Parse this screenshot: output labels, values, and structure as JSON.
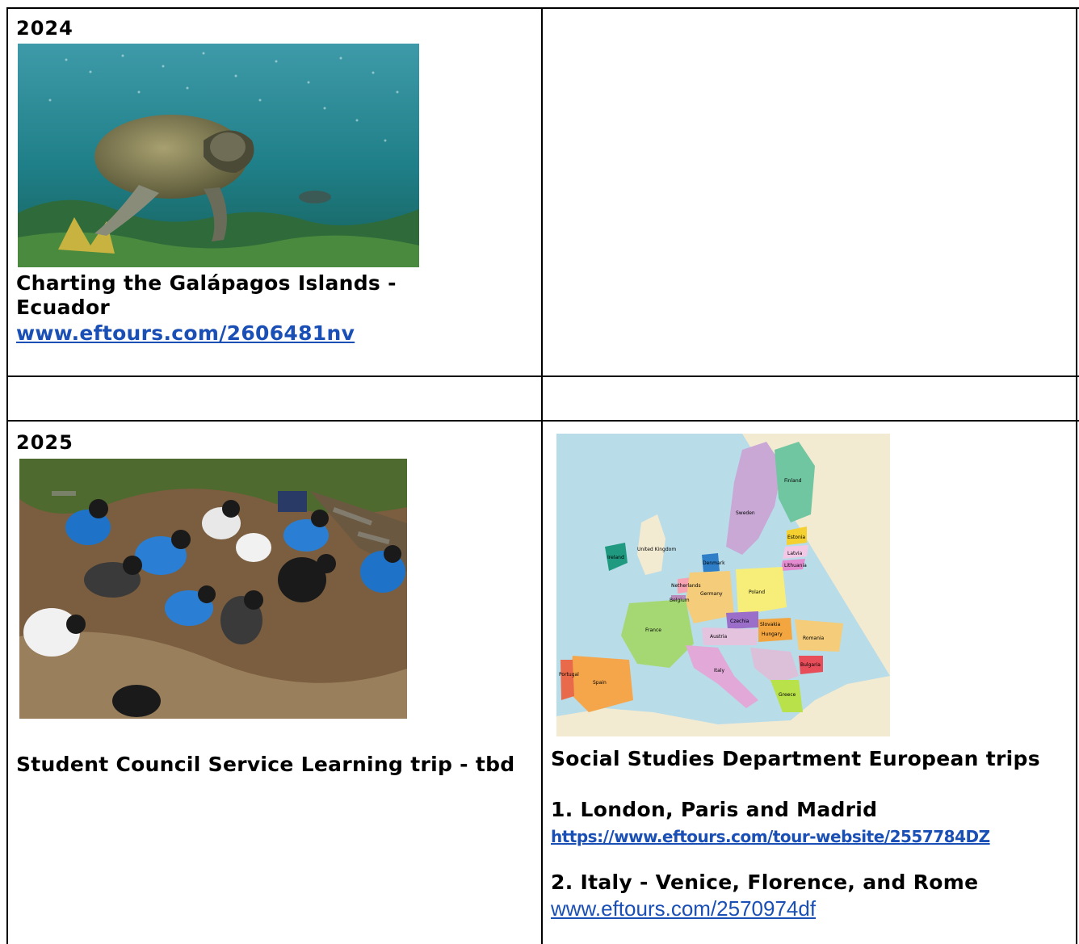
{
  "cells": {
    "galapagos": {
      "year": "2024",
      "image_alt": "sea turtle underwater",
      "title": "Charting the Galápagos Islands - Ecuador",
      "link": "www.eftours.com/2606481nv"
    },
    "service": {
      "year": "2025",
      "image_alt": "students working outdoors",
      "title": "Student Council Service Learning trip - tbd"
    },
    "europe": {
      "image_alt": "map of Europe",
      "title": "Social Studies Department European trips",
      "trip1_title": "1.  London, Paris and Madrid",
      "trip1_link": "https://www.eftours.com/tour-website/2557784DZ",
      "trip2_title": "2.  Italy - Venice, Florence, and Rome",
      "trip2_link": "www.eftours.com/2570974df"
    }
  },
  "map_labels": [
    "Finland",
    "Sweden",
    "Estonia",
    "Latvia",
    "Lithuania",
    "United Kingdom",
    "Ireland",
    "Denmark",
    "Netherlands",
    "Germany",
    "Poland",
    "Belgium",
    "France",
    "Czechia",
    "Slovakia",
    "Austria",
    "Hungary",
    "Romania",
    "Portugal",
    "Spain",
    "Italy",
    "Bulgaria",
    "Greece"
  ]
}
